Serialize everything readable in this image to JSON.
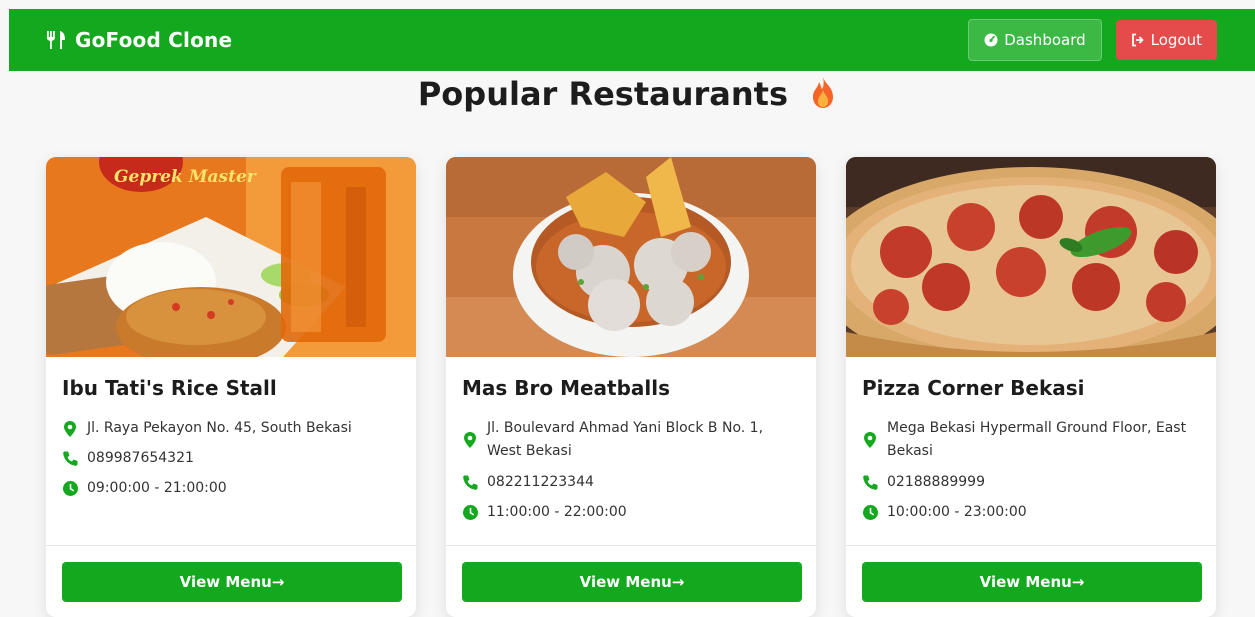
{
  "navbar": {
    "brand": "GoFood Clone",
    "dashboard_label": "Dashboard",
    "logout_label": "Logout"
  },
  "page": {
    "title": "Popular Restaurants"
  },
  "restaurants": [
    {
      "name": "Ibu Tati's Rice Stall",
      "address": "Jl. Raya Pekayon No. 45, South Bekasi",
      "phone": "089987654321",
      "hours": "09:00:00 - 21:00:00",
      "button_label": "View Menu→",
      "image_sign_text": "Geprek Master"
    },
    {
      "name": "Mas Bro Meatballs",
      "address": "Jl. Boulevard Ahmad Yani Block B No. 1, West Bekasi",
      "phone": "082211223344",
      "hours": "11:00:00 - 22:00:00",
      "button_label": "View Menu→"
    },
    {
      "name": "Pizza Corner Bekasi",
      "address": "Mega Bekasi Hypermall Ground Floor, East Bekasi",
      "phone": "02188889999",
      "hours": "10:00:00 - 23:00:00",
      "button_label": "View Menu→"
    }
  ],
  "icons": {
    "brand": "utensils-icon",
    "dashboard": "gauge-icon",
    "logout": "sign-out-icon",
    "title": "fire-icon",
    "address": "map-marker-icon",
    "phone": "phone-icon",
    "hours": "clock-icon"
  },
  "colors": {
    "primary": "#14a81e",
    "danger": "#e54b4b",
    "background": "#f7f7f7"
  }
}
